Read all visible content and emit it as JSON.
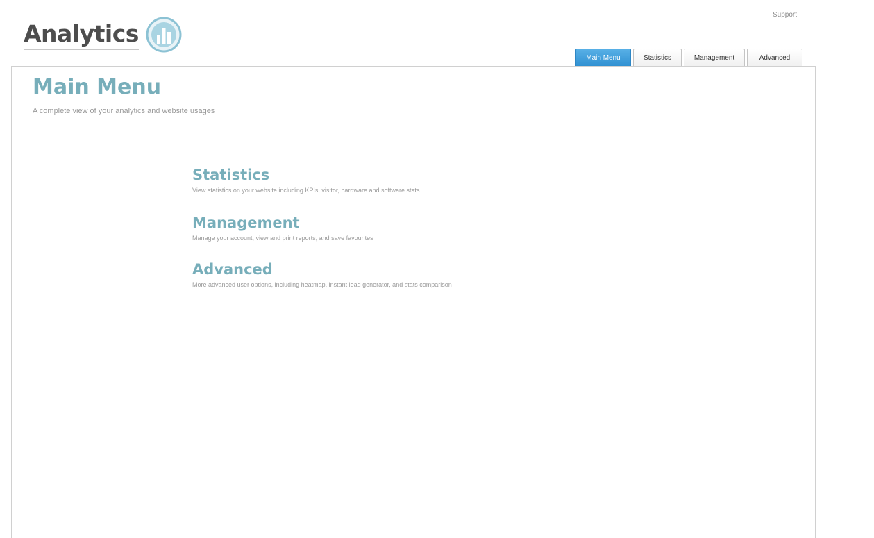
{
  "brand": {
    "logo_text": "Analytics"
  },
  "header": {
    "support_label": "Support"
  },
  "tabs": [
    {
      "label": "Main Menu",
      "active": true
    },
    {
      "label": "Statistics",
      "active": false
    },
    {
      "label": "Management",
      "active": false
    },
    {
      "label": "Advanced",
      "active": false
    }
  ],
  "page": {
    "title": "Main Menu",
    "subtitle": "A complete view of your analytics and website usages"
  },
  "sections": [
    {
      "title": "Statistics",
      "description": "View statistics on your website including KPIs, visitor, hardware and software stats"
    },
    {
      "title": "Management",
      "description": "Manage your account, view and print reports, and save favourites"
    },
    {
      "title": "Advanced",
      "description": "More advanced user options, including heatmap, instant lead generator, and stats comparison"
    }
  ],
  "colors": {
    "accent": "#77aeba",
    "active_tab": "#3a9bdc",
    "logo_text": "#4d4d4d",
    "muted_text": "#9a9a9a"
  },
  "icons": {
    "logo": "analytics-logo-icon"
  }
}
